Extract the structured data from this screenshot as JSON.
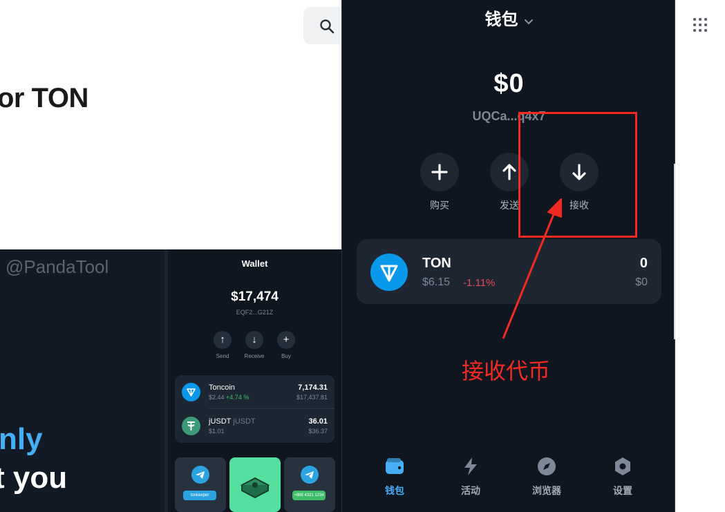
{
  "background": {
    "hero_title": "or TON",
    "watermark": "@PandaTool",
    "banner_line1": "nly",
    "banner_line2": "t you",
    "mockup": {
      "title": "Wallet",
      "balance": "$17,474",
      "address": "EQF2...G21Z",
      "actions": [
        {
          "label": "Send",
          "glyph": "↑"
        },
        {
          "label": "Receive",
          "glyph": "↓"
        },
        {
          "label": "Buy",
          "glyph": "+"
        }
      ],
      "tokens": [
        {
          "name": "Toncoin",
          "suffix": "",
          "price": "$2.44",
          "change": "+4.74 %",
          "amount": "7,174.31",
          "value": "$17,437.81"
        },
        {
          "name": "jUSDT",
          "suffix": "jUSDT",
          "price": "$1.01",
          "change": "",
          "amount": "36.01",
          "value": "$36.37"
        }
      ],
      "cards": [
        {
          "pill": "tonkeeper",
          "pill_color": "#2aa3e0"
        },
        {
          "pill": "",
          "pill_color": "#55e0a0"
        },
        {
          "pill": "+888 4321 1234",
          "pill_color": "#3ebd6a"
        }
      ]
    }
  },
  "wallet": {
    "header_title": "钱包",
    "balance": "$0",
    "address": "UQCa...q4x7",
    "actions": [
      {
        "label": "购买",
        "icon": "plus-icon"
      },
      {
        "label": "发送",
        "icon": "arrow-up-icon"
      },
      {
        "label": "接收",
        "icon": "arrow-down-icon"
      }
    ],
    "token": {
      "name": "TON",
      "price": "$6.15",
      "change": "-1.11%",
      "amount": "0",
      "value": "$0"
    },
    "tabs": [
      {
        "label": "钱包",
        "icon": "wallet-icon",
        "active": true
      },
      {
        "label": "活动",
        "icon": "lightning-icon",
        "active": false
      },
      {
        "label": "浏览器",
        "icon": "compass-icon",
        "active": false
      },
      {
        "label": "设置",
        "icon": "gear-icon",
        "active": false
      }
    ]
  },
  "annotation": {
    "text": "接收代币",
    "color": "#f32a22"
  },
  "colors": {
    "accent": "#45aef5",
    "ton_blue": "#0a98eb",
    "negative": "#e2455c",
    "positive": "#3ebd6a",
    "panel_bg": "#10161f"
  }
}
